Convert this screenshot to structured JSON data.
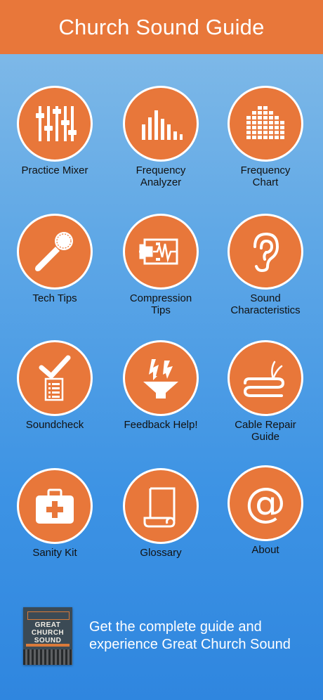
{
  "header": {
    "title": "Church Sound Guide"
  },
  "tiles": [
    {
      "label_line1": "Practice Mixer",
      "label_line2": "",
      "icon": "mixer-faders-icon"
    },
    {
      "label_line1": "Frequency",
      "label_line2": "Analyzer",
      "icon": "frequency-bars-icon"
    },
    {
      "label_line1": "Frequency",
      "label_line2": "Chart",
      "icon": "frequency-chart-icon"
    },
    {
      "label_line1": "Tech Tips",
      "label_line2": "",
      "icon": "microphone-icon"
    },
    {
      "label_line1": "Compression",
      "label_line2": "Tips",
      "icon": "compression-clamp-icon"
    },
    {
      "label_line1": "Sound",
      "label_line2": "Characteristics",
      "icon": "ear-icon"
    },
    {
      "label_line1": "Soundcheck",
      "label_line2": "",
      "icon": "checklist-icon"
    },
    {
      "label_line1": "Feedback Help!",
      "label_line2": "",
      "icon": "feedback-speaker-icon"
    },
    {
      "label_line1": "Cable Repair",
      "label_line2": "Guide",
      "icon": "cable-icon"
    },
    {
      "label_line1": "Sanity Kit",
      "label_line2": "",
      "icon": "first-aid-kit-icon"
    },
    {
      "label_line1": "Glossary",
      "label_line2": "",
      "icon": "scroll-icon"
    },
    {
      "label_line1": "About",
      "label_line2": "",
      "icon": "at-sign-icon"
    }
  ],
  "promo": {
    "book_title_line1": "GREAT",
    "book_title_line2": "CHURCH",
    "book_title_line3": "SOUND",
    "text_line1": "Get the complete guide and",
    "text_line2": "experience Great Church Sound"
  },
  "colors": {
    "accent": "#e8773a",
    "background_top": "#86bde8",
    "background_bottom": "#2f86df"
  }
}
